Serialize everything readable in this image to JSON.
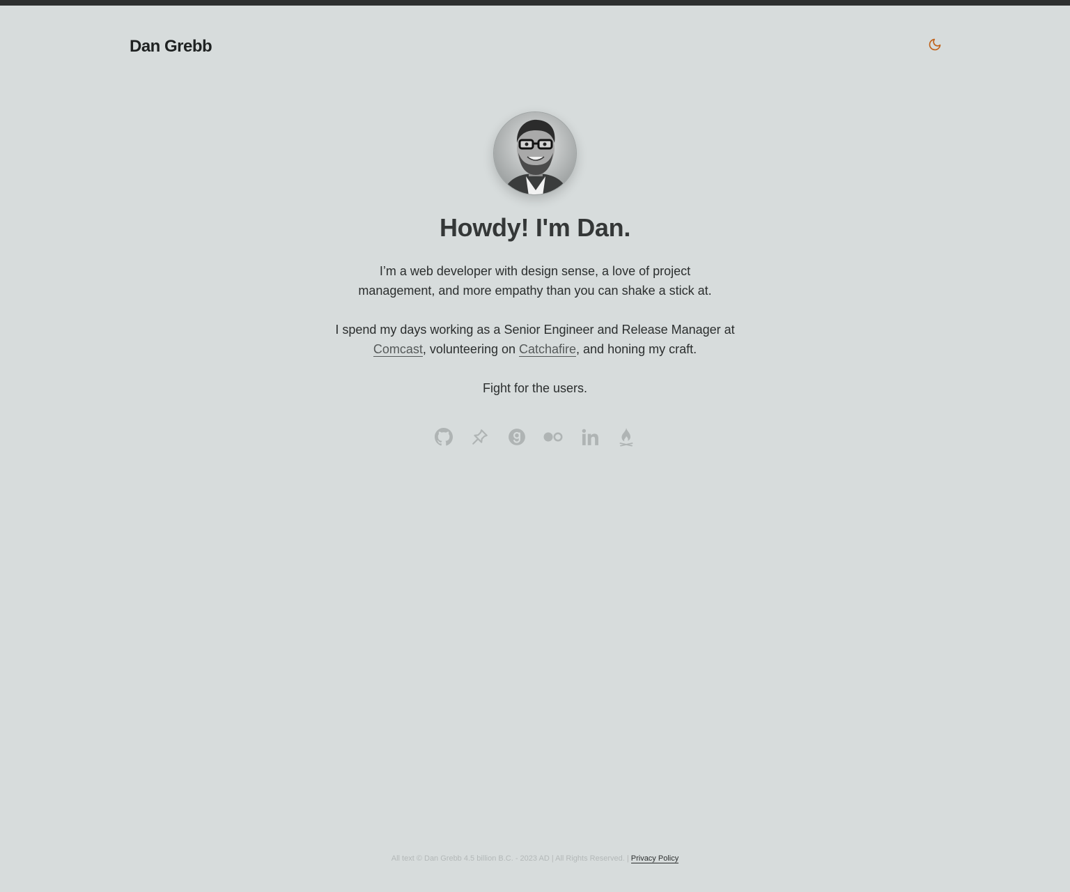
{
  "header": {
    "site_title": "Dan Grebb",
    "theme_toggle_icon": "moon-icon",
    "accent_color": "#c0621a"
  },
  "hero": {
    "avatar_icon": "profile-photo",
    "heading": "Howdy! I'm Dan.",
    "intro": "I’m a web developer with design sense, a love of project management, and more empathy than you can shake a stick at.",
    "work": {
      "prefix": "I spend my days working as a Senior Engineer and Release Manager at ",
      "link1": "Comcast",
      "middle": ", volunteering on ",
      "link2": "Catchafire",
      "suffix": ", and honing my craft."
    },
    "tagline": "Fight for the users."
  },
  "social": [
    {
      "name": "github-icon"
    },
    {
      "name": "pinboard-icon"
    },
    {
      "name": "goodreads-icon"
    },
    {
      "name": "flickr-icon"
    },
    {
      "name": "linkedin-icon"
    },
    {
      "name": "campfire-icon"
    }
  ],
  "footer": {
    "copyright": "All text © Dan Grebb 4.5 billion B.C. - 2023 AD | All Rights Reserved. | ",
    "privacy_link": "Privacy Policy"
  }
}
